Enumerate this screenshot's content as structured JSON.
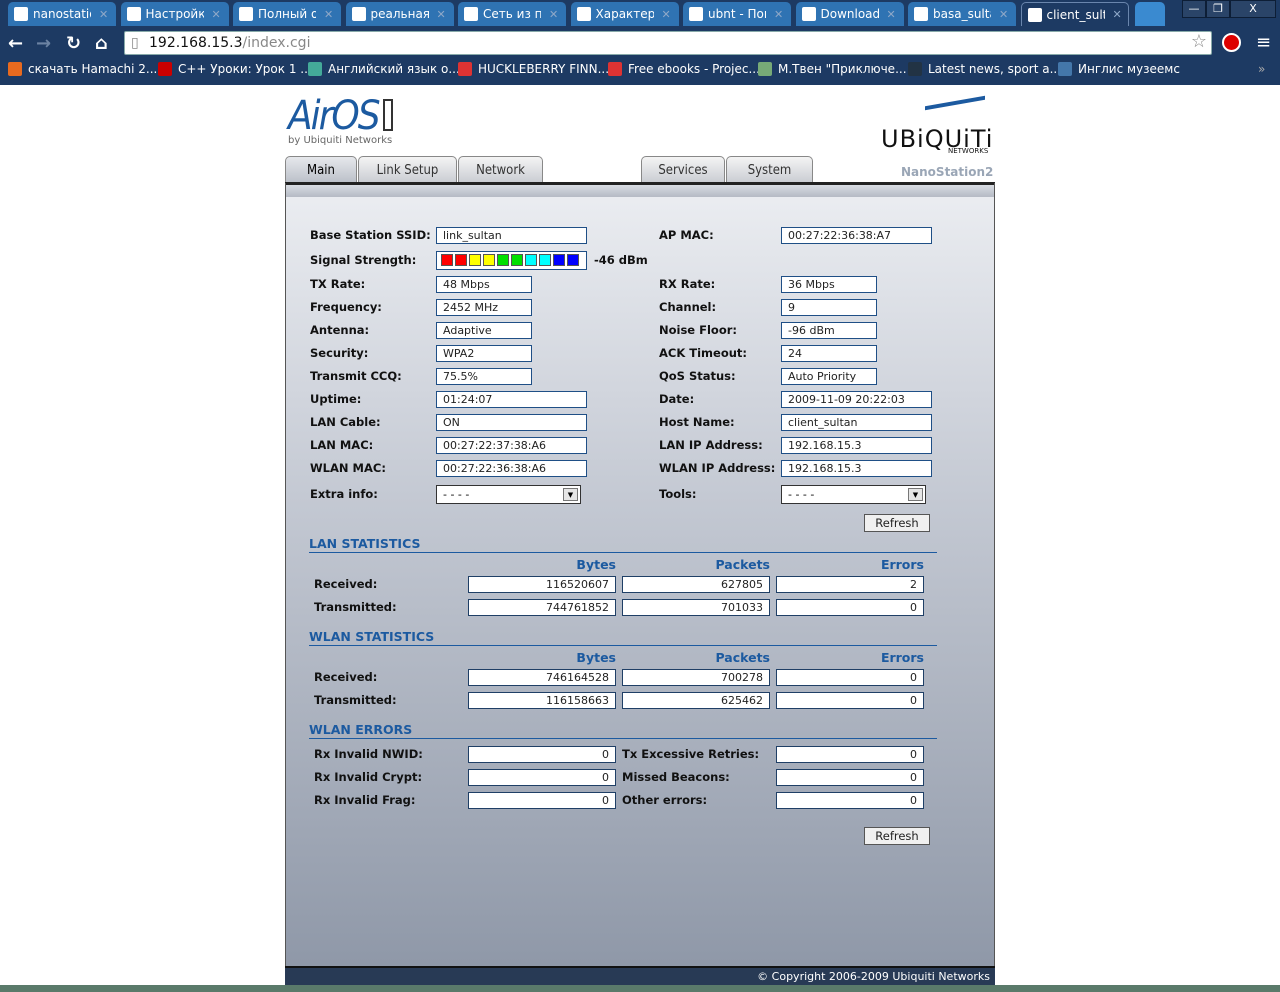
{
  "browser": {
    "tabs": [
      {
        "title": "nanostatio",
        "icon": "g"
      },
      {
        "title": "Настройка",
        "icon": "globe"
      },
      {
        "title": "Полный о",
        "icon": "7"
      },
      {
        "title": "реальная с",
        "icon": "g"
      },
      {
        "title": "Сеть из па",
        "icon": "LAN"
      },
      {
        "title": "Характери",
        "icon": "cart"
      },
      {
        "title": "ubnt - Пои",
        "icon": "g"
      },
      {
        "title": "Download:",
        "icon": "ubnt"
      },
      {
        "title": "basa_sultar",
        "icon": "ubnt"
      },
      {
        "title": "client_sulta",
        "icon": "ubnt"
      }
    ],
    "url_host": "192.168.15.3",
    "url_path": "/index.cgi",
    "bookmarks": [
      "скачать Hamachi 2....",
      "C++ Уроки: Урок 1 ...",
      "Английский язык о...",
      "HUCKLEBERRY FINN...",
      "Free ebooks - Projec...",
      "М.Твен \"Приключе...",
      "Latest news, sport a...",
      "Инглис музеемс"
    ],
    "more": "»",
    "win": {
      "min": "—",
      "max": "❐",
      "close": "X"
    }
  },
  "header": {
    "logo": "AirOS",
    "logo_sub": "by Ubiquiti Networks",
    "brand": "UBiQUiTi",
    "brand_sub": "NETWORKS",
    "device": "NanoStation2"
  },
  "tabs": [
    "Main",
    "Link Setup",
    "Network",
    "Services",
    "System"
  ],
  "status": {
    "left": [
      {
        "label": "Base Station SSID:",
        "value": "link_sultan"
      },
      {
        "label": "Signal Strength:",
        "value": "-46 dBm"
      },
      {
        "label": "TX Rate:",
        "value": "48 Mbps"
      },
      {
        "label": "Frequency:",
        "value": "2452 MHz"
      },
      {
        "label": "Antenna:",
        "value": "Adaptive"
      },
      {
        "label": "Security:",
        "value": "WPA2"
      },
      {
        "label": "Transmit CCQ:",
        "value": " 75.5%"
      },
      {
        "label": "Uptime:",
        "value": "01:24:07"
      },
      {
        "label": "LAN Cable:",
        "value": "ON"
      },
      {
        "label": "LAN MAC:",
        "value": "00:27:22:37:38:A6"
      },
      {
        "label": "WLAN MAC:",
        "value": "00:27:22:36:38:A6"
      },
      {
        "label": "Extra info:",
        "value": "- - - -"
      }
    ],
    "right": [
      {
        "label": "AP MAC:",
        "value": "00:27:22:36:38:A7"
      },
      {
        "label": "RX Rate:",
        "value": "36 Mbps"
      },
      {
        "label": "Channel:",
        "value": "9"
      },
      {
        "label": "Noise Floor:",
        "value": "-96 dBm"
      },
      {
        "label": "ACK Timeout:",
        "value": "24"
      },
      {
        "label": "QoS Status:",
        "value": "Auto Priority"
      },
      {
        "label": "Date:",
        "value": "2009-11-09 20:22:03"
      },
      {
        "label": "Host Name:",
        "value": "client_sultan"
      },
      {
        "label": "LAN IP Address:",
        "value": "192.168.15.3"
      },
      {
        "label": "WLAN IP Address:",
        "value": "192.168.15.3"
      },
      {
        "label": "Tools:",
        "value": "- - - -"
      }
    ],
    "signal_bars": 10,
    "signal_colors": [
      "#ff0000",
      "#ff0000",
      "#ffff00",
      "#ffff00",
      "#00e000",
      "#00e000",
      "#00ffff",
      "#00ffff",
      "#0000ff",
      "#0000ff"
    ]
  },
  "refresh": "Refresh",
  "lan_stats": {
    "title": "LAN STATISTICS",
    "cols": [
      "Bytes",
      "Packets",
      "Errors"
    ],
    "rows": [
      {
        "label": "Received:",
        "values": [
          "116520607",
          "627805",
          "2"
        ]
      },
      {
        "label": "Transmitted:",
        "values": [
          "744761852",
          "701033",
          "0"
        ]
      }
    ]
  },
  "wlan_stats": {
    "title": "WLAN STATISTICS",
    "cols": [
      "Bytes",
      "Packets",
      "Errors"
    ],
    "rows": [
      {
        "label": "Received:",
        "values": [
          "746164528",
          "700278",
          "0"
        ]
      },
      {
        "label": "Transmitted:",
        "values": [
          "116158663",
          "625462",
          "0"
        ]
      }
    ]
  },
  "wlan_errors": {
    "title": "WLAN ERRORS",
    "left": [
      {
        "label": "Rx Invalid NWID:",
        "value": "0"
      },
      {
        "label": "Rx Invalid Crypt:",
        "value": "0"
      },
      {
        "label": "Rx Invalid Frag:",
        "value": "0"
      }
    ],
    "right": [
      {
        "label": "Tx Excessive Retries:",
        "value": "0"
      },
      {
        "label": "Missed Beacons:",
        "value": "0"
      },
      {
        "label": "Other errors:",
        "value": "0"
      }
    ]
  },
  "footer": "© Copyright 2006-2009 Ubiquiti Networks"
}
